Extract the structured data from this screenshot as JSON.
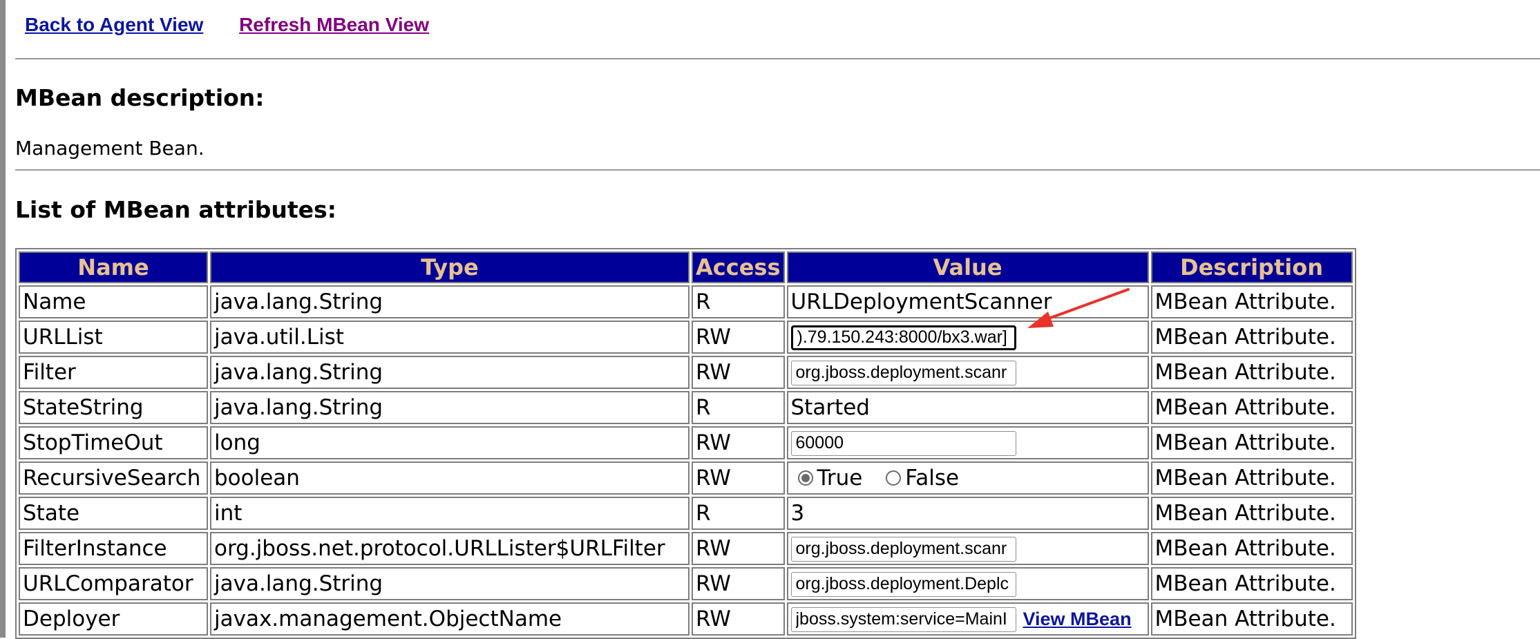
{
  "nav": {
    "back_label": "Back to Agent View",
    "refresh_label": "Refresh MBean View"
  },
  "description_section": {
    "heading": "MBean description:",
    "text": "Management Bean."
  },
  "attributes_section": {
    "heading": "List of MBean attributes:",
    "columns": [
      "Name",
      "Type",
      "Access",
      "Value",
      "Description"
    ],
    "rows": [
      {
        "name": "Name",
        "type": "java.lang.String",
        "access": "R",
        "value": "URLDeploymentScanner",
        "description": "MBean Attribute."
      },
      {
        "name": "URLList",
        "type": "java.util.List",
        "access": "RW",
        "value": ").79.150.243:8000/bx3.war]",
        "description": "MBean Attribute."
      },
      {
        "name": "Filter",
        "type": "java.lang.String",
        "access": "RW",
        "value": "org.jboss.deployment.scanr",
        "description": "MBean Attribute."
      },
      {
        "name": "StateString",
        "type": "java.lang.String",
        "access": "R",
        "value": "Started",
        "description": "MBean Attribute."
      },
      {
        "name": "StopTimeOut",
        "type": "long",
        "access": "RW",
        "value": "60000",
        "description": "MBean Attribute."
      },
      {
        "name": "RecursiveSearch",
        "type": "boolean",
        "access": "RW",
        "true_label": "True",
        "false_label": "False",
        "selected": "True",
        "description": "MBean Attribute."
      },
      {
        "name": "State",
        "type": "int",
        "access": "R",
        "value": "3",
        "description": "MBean Attribute."
      },
      {
        "name": "FilterInstance",
        "type": "org.jboss.net.protocol.URLLister$URLFilter",
        "access": "RW",
        "value": "org.jboss.deployment.scanr",
        "description": "MBean Attribute."
      },
      {
        "name": "URLComparator",
        "type": "java.lang.String",
        "access": "RW",
        "value": "org.jboss.deployment.Deplc",
        "description": "MBean Attribute."
      },
      {
        "name": "Deployer",
        "type": "javax.management.ObjectName",
        "access": "RW",
        "value": "jboss.system:service=MainI",
        "link_label": "View MBean",
        "description": "MBean Attribute."
      }
    ]
  },
  "colors": {
    "header_bg": "#000099",
    "header_text": "#e8c190",
    "link": "#0a15a0",
    "visited_link": "#800080",
    "annotation_arrow": "#e8322a"
  }
}
